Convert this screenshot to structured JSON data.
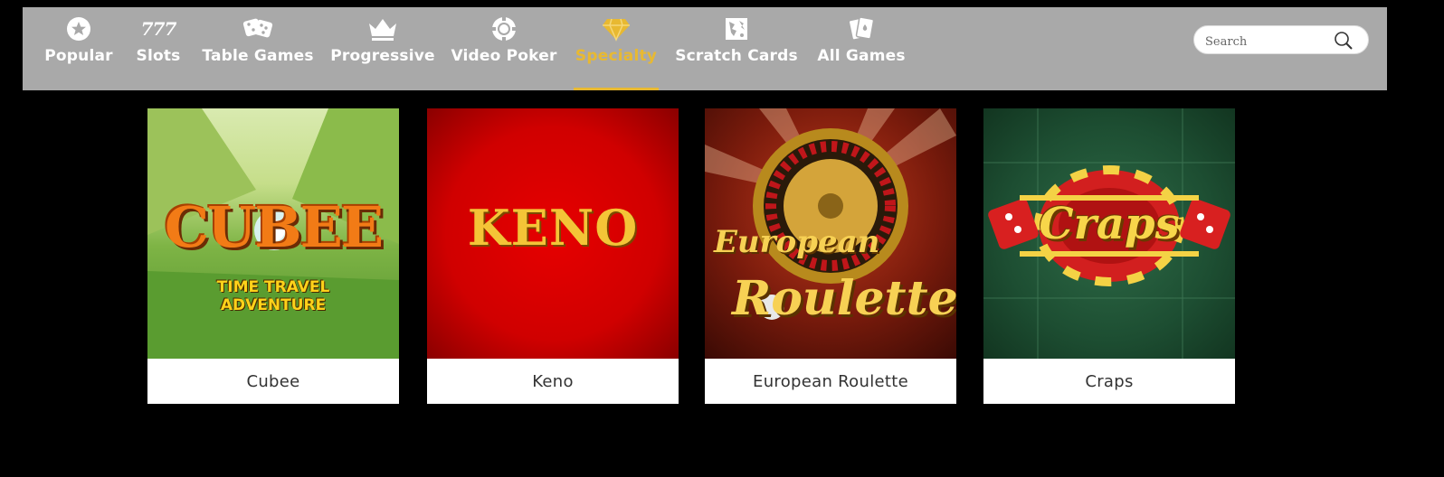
{
  "nav": {
    "items": [
      {
        "label": "Popular",
        "icon": "star-icon"
      },
      {
        "label": "Slots",
        "icon": "777-icon"
      },
      {
        "label": "Table Games",
        "icon": "dice-icon"
      },
      {
        "label": "Progressive",
        "icon": "crown-icon"
      },
      {
        "label": "Video Poker",
        "icon": "poker-chip-icon"
      },
      {
        "label": "Specialty",
        "icon": "diamond-icon"
      },
      {
        "label": "Scratch Cards",
        "icon": "scratch-card-icon"
      },
      {
        "label": "All Games",
        "icon": "cards-icon"
      }
    ],
    "slots_glyph": "777",
    "active": "Specialty",
    "active_color": "#e8b931"
  },
  "search": {
    "placeholder": "Search"
  },
  "games": [
    {
      "title": "Cubee",
      "logo_line1": "CUBEE",
      "logo_line2": "TIME TRAVEL ADVENTURE"
    },
    {
      "title": "Keno",
      "logo_line1": "KENO"
    },
    {
      "title": "European Roulette",
      "logo_line1": "European",
      "logo_line2": "Roulette"
    },
    {
      "title": "Craps",
      "logo_line1": "Craps"
    }
  ]
}
